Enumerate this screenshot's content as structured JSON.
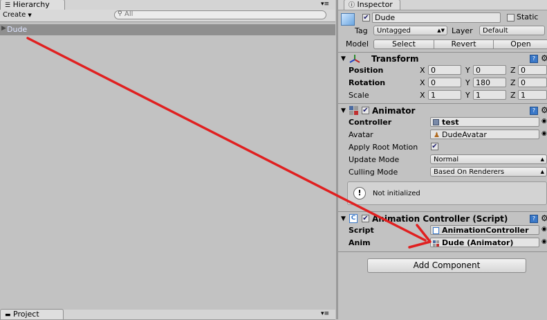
{
  "hierarchy": {
    "tab_title": "Hierarchy",
    "create_label": "Create",
    "search_placeholder": "All",
    "items": [
      {
        "label": "Dude"
      }
    ]
  },
  "project": {
    "tab_title": "Project"
  },
  "inspector": {
    "tab_title": "Inspector",
    "object": {
      "enabled": true,
      "name": "Dude",
      "static_label": "Static",
      "tag_label": "Tag",
      "tag_value": "Untagged",
      "layer_label": "Layer",
      "layer_value": "Default",
      "model_label": "Model",
      "select_label": "Select",
      "revert_label": "Revert",
      "open_label": "Open"
    },
    "transform": {
      "title": "Transform",
      "position_label": "Position",
      "rotation_label": "Rotation",
      "scale_label": "Scale",
      "x": "X",
      "y": "Y",
      "z": "Z",
      "position": [
        "0",
        "0",
        "0"
      ],
      "rotation": [
        "0",
        "180",
        "0"
      ],
      "scale": [
        "1",
        "1",
        "1"
      ]
    },
    "animator": {
      "title": "Animator",
      "controller_label": "Controller",
      "controller_value": "test",
      "avatar_label": "Avatar",
      "avatar_value": "DudeAvatar",
      "apply_root_motion_label": "Apply Root Motion",
      "apply_root_motion": true,
      "update_mode_label": "Update Mode",
      "update_mode_value": "Normal",
      "culling_mode_label": "Culling Mode",
      "culling_mode_value": "Based On Renderers",
      "info_message": "Not initialized"
    },
    "animation_controller": {
      "title": "Animation Controller (Script)",
      "script_label": "Script",
      "script_value": "AnimationController",
      "anim_label": "Anim",
      "anim_value": "Dude (Animator)"
    },
    "add_component_label": "Add Component"
  },
  "colors": {
    "background": "#c2c2c2",
    "selection": "#8f8f8f",
    "selected_text": "#dde4ff",
    "annotation_arrow": "#e02020"
  }
}
